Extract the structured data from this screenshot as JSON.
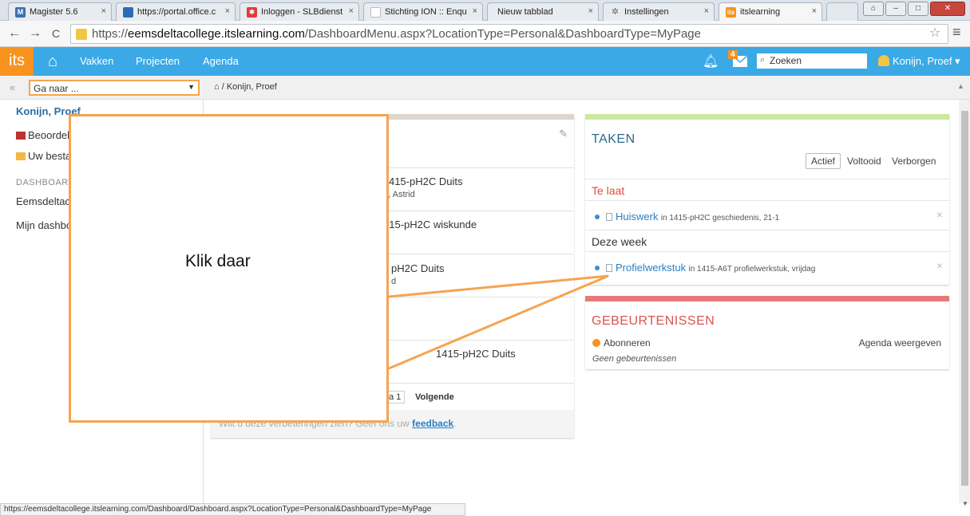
{
  "browser": {
    "tabs": [
      {
        "title": "Magister 5.6",
        "icon_color": "#3b6fb6",
        "close": "×"
      },
      {
        "title": "https://portal.office.c",
        "icon_color": "#2a6bb8",
        "close": "×"
      },
      {
        "title": "Inloggen - SLBdienst",
        "icon_color": "#e23b3b",
        "close": "×"
      },
      {
        "title": "Stichting ION :: Enqu",
        "icon_color": "#cccccc",
        "close": "×"
      },
      {
        "title": "Nieuw tabblad",
        "icon_color": "#cccccc",
        "close": "×"
      },
      {
        "title": "Instellingen",
        "icon_color": "#888888",
        "close": "×"
      },
      {
        "title": "itslearning",
        "icon_color": "#f7931e",
        "close": "×"
      }
    ],
    "url_scheme": "https://",
    "url_domain": "eemsdeltacollege.itslearning.com",
    "url_path": "/DashboardMenu.aspx?LocationType=Personal&DashboardType=MyPage",
    "status_url": "https://eemsdeltacollege.itslearning.com/Dashboard/Dashboard.aspx?LocationType=Personal&DashboardType=MyPage"
  },
  "topnav": {
    "logo": "its",
    "links": [
      "Vakken",
      "Projecten",
      "Agenda"
    ],
    "message_count": "4",
    "search_placeholder": "Zoeken",
    "user_name": "Konijn, Proef"
  },
  "breadcrumb": {
    "goto_placeholder": "Ga naar ...",
    "path": "/ Konijn, Proef"
  },
  "sidebar": {
    "user": "Konijn, Proef",
    "items": [
      "Beoordelingen",
      "Uw bestanden"
    ],
    "dashboards_heading": "DASHBOARDS",
    "dashboards": [
      "Eemsdeltacollege",
      "Mijn dashboard"
    ]
  },
  "middle": {
    "rows": [
      {
        "title": "in 1415-pH2C Duits",
        "sub": "n, Astrid"
      },
      {
        "title": "415-pH2C wiskunde",
        "sub": ""
      },
      {
        "title": "pH2C Duits",
        "sub": "d"
      },
      {
        "title": "",
        "sub": ""
      },
      {
        "title": "1415-pH2C Duits",
        "sub": ""
      }
    ],
    "pager_current": "a 1",
    "pager_next": "Volgende",
    "feedback_text": "Wilt u deze verbeteringen zien? Geef ons uw",
    "feedback_link": "feedback"
  },
  "taken": {
    "title": "TAKEN",
    "filters": [
      "Actief",
      "Voltooid",
      "Verborgen"
    ],
    "late_heading": "Te laat",
    "late_tasks": [
      {
        "name": "Huiswerk",
        "meta": "in 1415-pH2C geschiedenis, 21-1"
      }
    ],
    "week_heading": "Deze week",
    "week_tasks": [
      {
        "name": "Profielwerkstuk",
        "meta": "in 1415-A6T profielwerkstuk, vrijdag"
      }
    ]
  },
  "events": {
    "title": "GEBEURTENISSEN",
    "subscribe": "Abonneren",
    "agenda_link": "Agenda weergeven",
    "empty": "Geen gebeurtenissen"
  },
  "callout": {
    "text": "Klik daar",
    "color": "#f5a44f"
  },
  "colors": {
    "accent": "#3aa9e6",
    "logo": "#f7931e",
    "late": "#e04b3a",
    "link": "#2a7fc0"
  }
}
